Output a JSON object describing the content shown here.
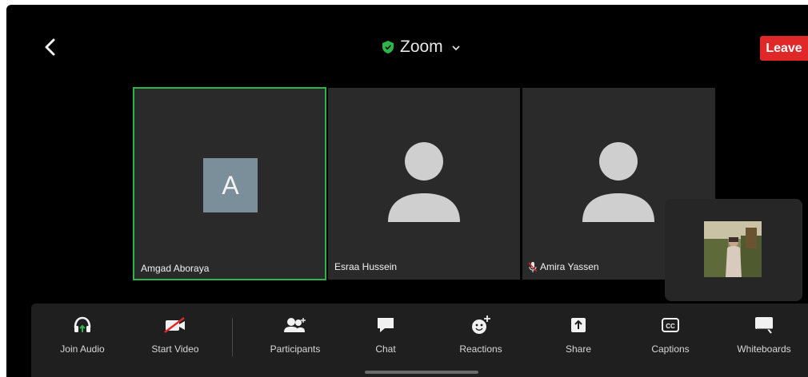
{
  "app": {
    "title": "Zoom",
    "leave_label": "Leave"
  },
  "participants": [
    {
      "name": "Amgad Aboraya",
      "initial": "A",
      "active_speaker": true
    },
    {
      "name": "Esraa Hussein"
    },
    {
      "name": "Amira Yassen",
      "muted": true
    }
  ],
  "toolbar": {
    "join_audio": "Join Audio",
    "start_video": "Start Video",
    "participants": "Participants",
    "chat": "Chat",
    "reactions": "Reactions",
    "share": "Share",
    "captions": "Captions",
    "whiteboards": "Whiteboards"
  },
  "colors": {
    "background": "#000000",
    "tile": "#2a2a2a",
    "active_border": "#2db54a",
    "leave": "#e02828",
    "toolbar": "#1f1f1f",
    "avatar_initial_bg": "#7b8f9b"
  },
  "icons": [
    "back-arrow-icon",
    "shield-icon",
    "chevron-down-icon",
    "headphones-icon",
    "video-off-icon",
    "participants-icon",
    "chat-icon",
    "reactions-icon",
    "share-icon",
    "captions-icon",
    "whiteboard-icon",
    "mic-muted-icon"
  ]
}
